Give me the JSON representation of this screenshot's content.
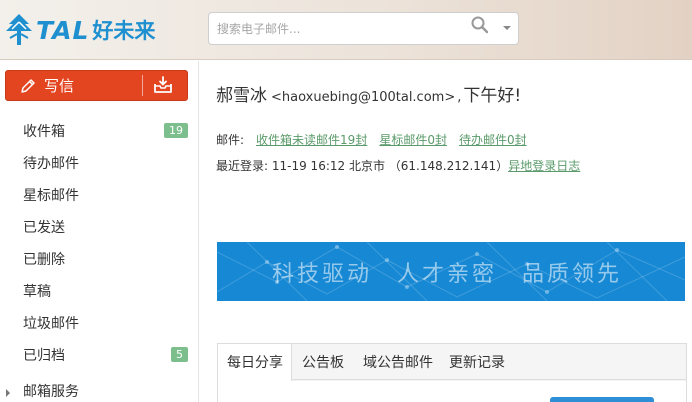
{
  "header": {
    "logo_text": "TAL",
    "logo_cn": "好未来",
    "search_placeholder": "搜索电子邮件..."
  },
  "sidebar": {
    "compose_label": "写信",
    "items": [
      {
        "label": "收件箱",
        "badge": "19"
      },
      {
        "label": "待办邮件",
        "badge": ""
      },
      {
        "label": "星标邮件",
        "badge": ""
      },
      {
        "label": "已发送",
        "badge": ""
      },
      {
        "label": "已删除",
        "badge": ""
      },
      {
        "label": "草稿",
        "badge": ""
      },
      {
        "label": "垃圾邮件",
        "badge": ""
      },
      {
        "label": "已归档",
        "badge": "5"
      }
    ],
    "services_label": "邮箱服务"
  },
  "main": {
    "user_name": "郝雪冰",
    "user_email": "<haoxuebing@100tal.com>",
    "greeting_comma": ",",
    "greeting": "下午好!",
    "mail_label": "邮件:",
    "mail_links": [
      "收件箱未读邮件19封",
      "星标邮件0封",
      "待办邮件0封"
    ],
    "login_label": "最近登录:",
    "login_info": "11-19 16:12 北京市 （61.148.212.141）",
    "login_log_link": "异地登录日志",
    "banner_text": "科技驱动　人才亲密　品质领先",
    "tabs": [
      "每日分享",
      "公告板",
      "域公告邮件",
      "更新记录"
    ]
  },
  "colors": {
    "brand_blue": "#1e8fcf",
    "compose_red": "#e2451f",
    "badge_green": "#7cbf8c",
    "link_green": "#5a9a6a",
    "banner_blue": "#1688d4"
  }
}
